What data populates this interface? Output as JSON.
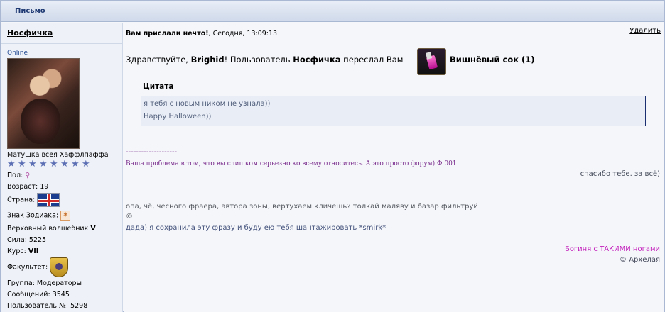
{
  "window": {
    "title": "Письмо"
  },
  "author": {
    "name": "Носфичка",
    "status": "Online",
    "rank_title": "Матушка всея Хаффлпаффа",
    "stars_count": 8,
    "gender_label": "Пол:",
    "gender_icon": "female-symbol",
    "age": "Возраст: 19",
    "country_label": "Страна:",
    "country_icon": "uk-flag",
    "zodiac_label": "Знак Зодиака:",
    "zodiac_icon": "zodiac-icon",
    "title_prefix": "Верховный волшебник",
    "title_value": "V",
    "power": "Сила: 5225",
    "course_label": "Курс:",
    "course_value": "VII",
    "faculty_label": "Факультет:",
    "faculty_icon": "hufflepuff-crest",
    "group": "Группа: Модераторы",
    "posts": "Сообщений: 3545",
    "user_number": "Пользователь №: 5298"
  },
  "message": {
    "header_bold": "Вам прислали нечто!",
    "header_rest": ", Сегодня, 13:09:13",
    "delete_label": "Удалить",
    "greeting": "Здравствуйте,",
    "recipient": "Brighid",
    "text_after_recipient": "! Пользователь",
    "sender": "Носфичка",
    "text_forwarded": "переслал Вам",
    "item_name": "Вишнёвый сок (1)",
    "item_icon": "cherry-juice-icon",
    "quote_title": "Цитата",
    "quote_lines": [
      "я тебя с новым ником не узнала))",
      "Happy Halloween))"
    ]
  },
  "signature": {
    "dashes": "--------------------",
    "line1": "Ваша проблема в том, что вы слишком серьезно ко всему относитесь. А это просто форум) Ф 001",
    "line2": "спасибо тебе. за всё)",
    "line3": "опа, чё, чесного фраера, автора зоны, вертухаем кличешь? толкай маляву и базар фильтруй",
    "line4": "©",
    "line5": "дада) я сохранила эту фразу и буду ею тебя шантажировать *smirk*",
    "line6": "Богиня с ТАКИМИ ногами",
    "line7": "© Архелая"
  },
  "colors": {
    "accent": "#1f3a73",
    "signature_purple": "#7b2d8d",
    "signature_pink": "#c31fbb",
    "quote_border": "#1a2f70"
  }
}
